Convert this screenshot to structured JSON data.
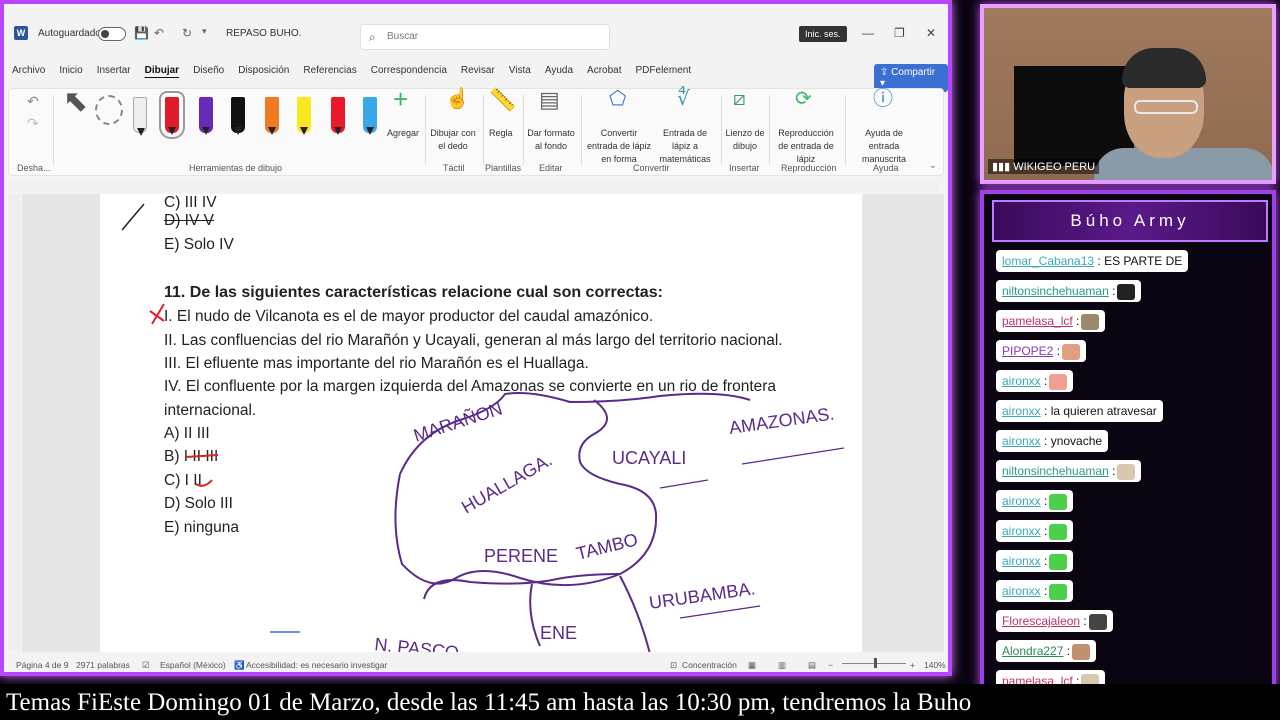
{
  "word": {
    "autosave_label": "Autoguardado",
    "doc_name": "REPASO BUHO.",
    "search_placeholder": "Buscar",
    "signin": "Inic. ses.",
    "share": "Compartir",
    "menu": [
      "Archivo",
      "Inicio",
      "Insertar",
      "Dibujar",
      "Diseño",
      "Disposición",
      "Referencias",
      "Correspondencia",
      "Revisar",
      "Vista",
      "Ayuda",
      "Acrobat",
      "PDFelement"
    ],
    "ribbon": {
      "undo_group": "Desha...",
      "drawing_tools_group": "Herramientas de dibujo",
      "add_label": "Agregar",
      "finger_draw": "Dibujar con el dedo",
      "touch_group": "Táctil",
      "ruler": "Regla",
      "templates_group": "Plantillas",
      "bg_format": "Dar formato al fondo",
      "edit_group": "Editar",
      "ink_to_shape": "Convertir entrada de lápiz en forma",
      "ink_to_math": "Entrada de lápiz a matemáticas",
      "convert_group": "Convertir",
      "canvas": "Lienzo de dibujo",
      "insert_group": "Insertar",
      "replay": "Reproducción de entrada de lápiz",
      "replay_group": "Reproducción",
      "ink_help": "Ayuda de entrada manuscrita",
      "help_group": "Ayuda"
    },
    "document": {
      "prev_options": [
        "C) III IV",
        "D) IV V",
        "E) Solo IV"
      ],
      "question_title": "11. De las siguientes características relacione cual son correctas:",
      "statements": [
        "I. El nudo de Vilcanota es el de mayor productor del caudal amazónico.",
        "II. Las confluencias del rio Marañón y Ucayali, generan al más largo del territorio nacional.",
        "III. El efluente mas importante del rio Marañón es el Huallaga.",
        "IV. El confluente por la margen izquierda del Amazonas se convierte en un rio de frontera",
        "internacional."
      ],
      "options": [
        "A) II III",
        "B) I II III",
        "C) I II",
        "D) Solo III",
        "E) ninguna"
      ],
      "map_labels": [
        "MARAÑON",
        "AMAZONAS.",
        "UCAYALI",
        "HUALLAGA.",
        "PERENE",
        "TAMBO",
        "URUBAMBA.",
        "ENE",
        "N. PASCO"
      ]
    },
    "status": {
      "page": "Página 4 de 9",
      "words": "2971 palabras",
      "language": "Español (México)",
      "accessibility": "Accesibilidad: es necesario investigar",
      "focus": "Concentración",
      "zoom": "140%"
    }
  },
  "webcam": {
    "label": "WIKIGEO PERU"
  },
  "chat": {
    "title": "Búho Army",
    "messages": [
      {
        "user": "lomar_Cabana13",
        "text": ": ES PARTE DE",
        "color": "#3aa8b8",
        "emote": ""
      },
      {
        "user": "niltonsinchehuaman",
        "text": ":",
        "color": "#2a9a8a",
        "emote": "#222"
      },
      {
        "user": "pamelasa_lcf",
        "text": ":",
        "color": "#c0306a",
        "emote": "#9a8a6a"
      },
      {
        "user": "PIPOPE2",
        "text": ":",
        "color": "#8a3ab8",
        "emote": "#e0a080"
      },
      {
        "user": "aironxx",
        "text": ":",
        "color": "#3aa8b8",
        "emote": "#f0a090"
      },
      {
        "user": "aironxx",
        "text": ": la quieren atravesar",
        "color": "#3aa8b8",
        "emote": ""
      },
      {
        "user": "aironxx",
        "text": ": ynovache",
        "color": "#3aa8b8",
        "emote": ""
      },
      {
        "user": "niltonsinchehuaman",
        "text": ":",
        "color": "#2a9a8a",
        "emote": "#d8c8b0"
      },
      {
        "user": "aironxx",
        "text": ":",
        "color": "#3aa8b8",
        "emote": "#4cd04c"
      },
      {
        "user": "aironxx",
        "text": ":",
        "color": "#3aa8b8",
        "emote": "#4cd04c"
      },
      {
        "user": "aironxx",
        "text": ":",
        "color": "#3aa8b8",
        "emote": "#4cd04c"
      },
      {
        "user": "aironxx",
        "text": ":",
        "color": "#3aa8b8",
        "emote": "#4cd04c"
      },
      {
        "user": "Florescajaleon",
        "text": ":",
        "color": "#c0306a",
        "emote": "#444"
      },
      {
        "user": "Alondra227",
        "text": ":",
        "color": "#2a8a5a",
        "emote": "#c09070"
      },
      {
        "user": "pamelasa_lcf",
        "text": ":",
        "color": "#c0306a",
        "emote": "#d8c8b0"
      }
    ]
  },
  "ticker": "Temas FiEste Domingo 01 de Marzo, desde las 11:45 am hasta las 10:30 pm, tendremos la Buho"
}
